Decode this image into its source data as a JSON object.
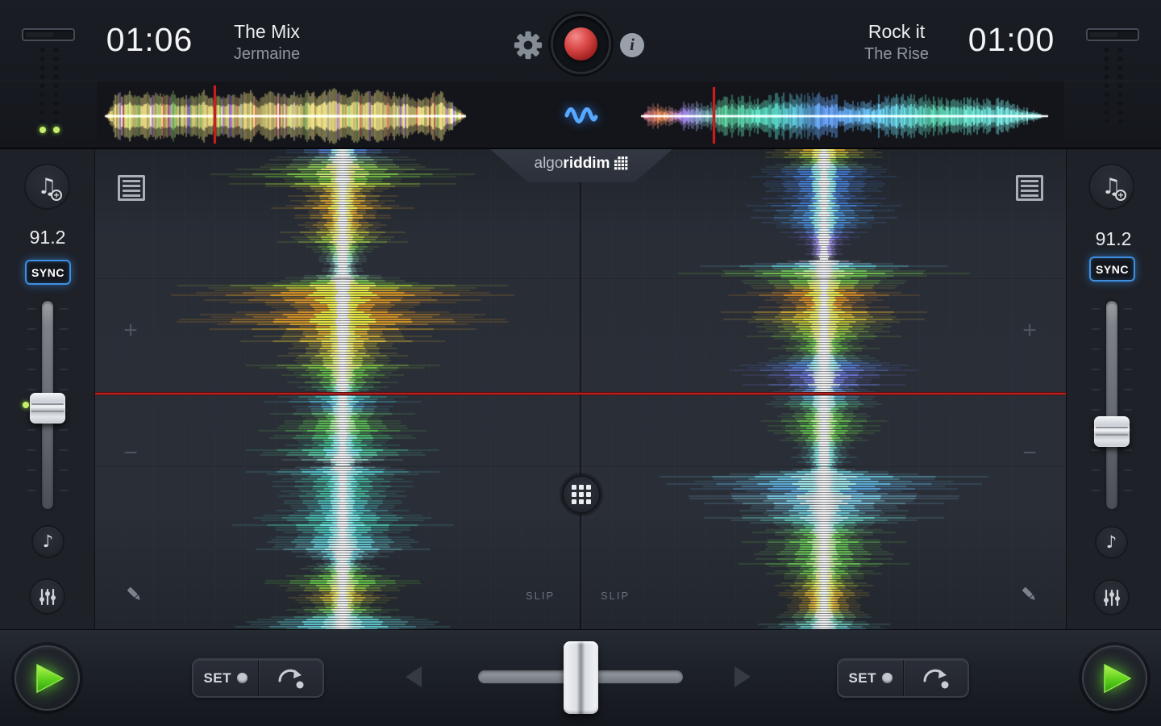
{
  "top_bar": {
    "deck_a": {
      "elapsed": "01:06",
      "title": "The Mix",
      "artist": "Jermaine"
    },
    "deck_b": {
      "remaining": "01:00",
      "title": "Rock it",
      "artist": "The Rise"
    }
  },
  "logo": {
    "prefix": "algo",
    "suffix": "riddim"
  },
  "deck_a": {
    "bpm": "91.2",
    "sync_label": "SYNC",
    "slip_label": "SLIP",
    "zoom_in": "+",
    "zoom_out": "−"
  },
  "deck_b": {
    "bpm": "91.2",
    "sync_label": "SYNC",
    "slip_label": "SLIP",
    "zoom_in": "+",
    "zoom_out": "−"
  },
  "transport": {
    "set_label": "SET"
  },
  "colors": {
    "accent_blue": "#4a90e2",
    "play_green": "#6fdc2e",
    "record_red": "#c43b3b",
    "playhead_red": "#c32020"
  }
}
